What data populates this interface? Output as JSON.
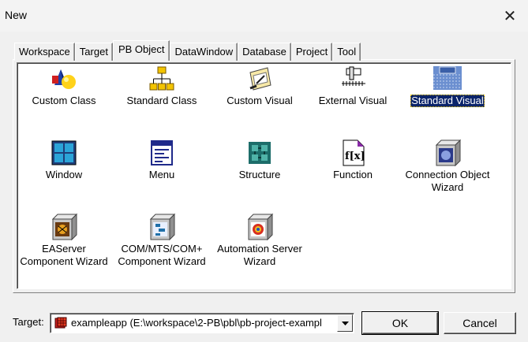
{
  "window": {
    "title": "New"
  },
  "tabs": [
    {
      "label": "Workspace"
    },
    {
      "label": "Target"
    },
    {
      "label": "PB Object",
      "active": true
    },
    {
      "label": "DataWindow"
    },
    {
      "label": "Database"
    },
    {
      "label": "Project"
    },
    {
      "label": "Tool"
    }
  ],
  "items": [
    {
      "label": "Custom Class",
      "icon": "custom-class-icon"
    },
    {
      "label": "Standard Class",
      "icon": "standard-class-icon"
    },
    {
      "label": "Custom Visual",
      "icon": "custom-visual-icon"
    },
    {
      "label": "External Visual",
      "icon": "external-visual-icon"
    },
    {
      "label": "Standard Visual",
      "icon": "standard-visual-icon",
      "selected": true
    },
    {
      "label": "Window",
      "icon": "window-icon"
    },
    {
      "label": "Menu",
      "icon": "menu-icon"
    },
    {
      "label": "Structure",
      "icon": "structure-icon"
    },
    {
      "label": "Function",
      "icon": "function-icon"
    },
    {
      "label": "Connection Object\nWizard",
      "icon": "connection-wizard-icon"
    },
    {
      "label": "EAServer\nComponent Wizard",
      "icon": "easerver-wizard-icon"
    },
    {
      "label": "COM/MTS/COM+\nComponent Wizard",
      "icon": "com-wizard-icon"
    },
    {
      "label": "Automation Server\nWizard",
      "icon": "automation-wizard-icon"
    }
  ],
  "target": {
    "label": "Target:",
    "value": "exampleapp (E:\\workspace\\2-PB\\pbl\\pb-project-exampl"
  },
  "buttons": {
    "ok": "OK",
    "cancel": "Cancel"
  },
  "colors": {
    "selection": "#0a246a",
    "dialog": "#f0f0f0"
  }
}
